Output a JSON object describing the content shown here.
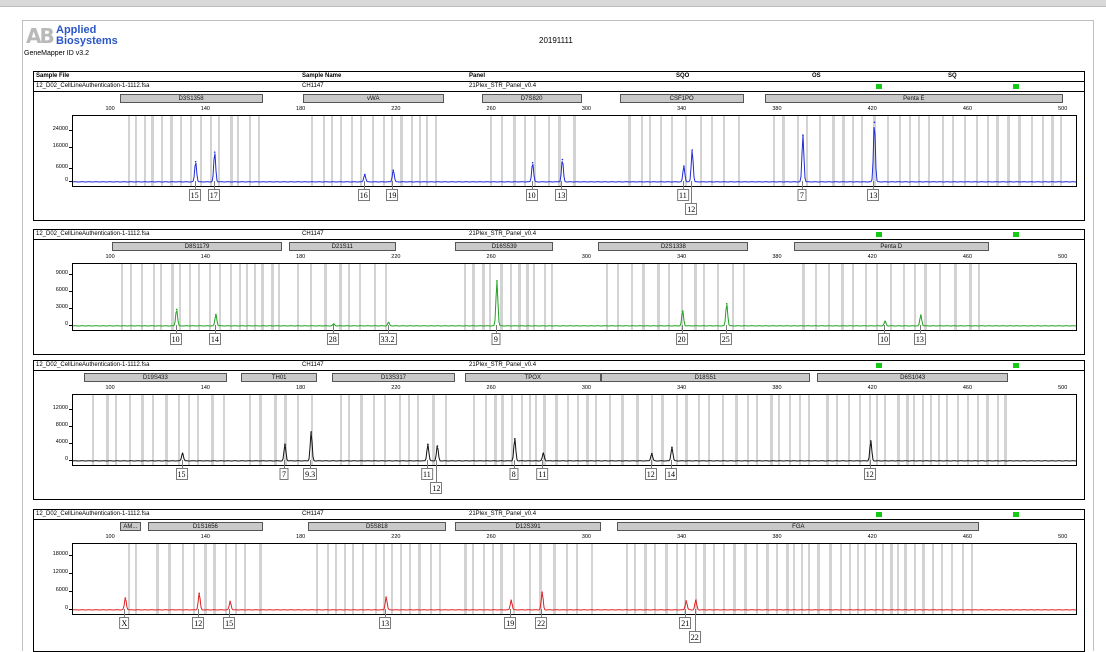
{
  "brand": {
    "mark": "AB",
    "name_line1": "Applied",
    "name_line2": "Biosystems"
  },
  "software": "GeneMapper ID v3.2",
  "run_date": "20191111",
  "columns": {
    "sample_file": "Sample File",
    "sample_name": "Sample Name",
    "panel": "Panel",
    "sqo": "SQO",
    "os": "OS",
    "sq": "SQ"
  },
  "colors": {
    "quality_ok": "#18c918",
    "blue_dye": "#1f2bd8",
    "green_dye": "#1fa21f",
    "black_dye": "#111111",
    "red_dye": "#e02020",
    "bin": "#d3d3d3"
  },
  "bp_axis": [
    100,
    140,
    180,
    220,
    260,
    300,
    340,
    380,
    420,
    460,
    500
  ],
  "panels": [
    {
      "dye": "blue",
      "color": "#1f2bd8",
      "sample_file": "12_D02_CellLineAuthentication-1-1112.fsa",
      "sample_name": "CH1147",
      "panel": "21Plex_STR_Panel_v0.4",
      "loci": [
        {
          "name": "D3S1358",
          "from": 104,
          "to": 164
        },
        {
          "name": "vWA",
          "from": 181,
          "to": 240
        },
        {
          "name": "D7S820",
          "from": 256,
          "to": 298
        },
        {
          "name": "CSF1PO",
          "from": 314,
          "to": 366
        },
        {
          "name": "Penta E",
          "from": 375,
          "to": 500
        }
      ],
      "yticks": [
        0,
        6000,
        16000,
        24000
      ],
      "ymax": 30000,
      "peaks": [
        {
          "bp": 135.5,
          "height": 9500,
          "label": "15"
        },
        {
          "bp": 143.5,
          "height": 14000,
          "label": "17"
        },
        {
          "bp": 206.5,
          "height": 3500,
          "label": "16"
        },
        {
          "bp": 218.5,
          "height": 5500,
          "label": "19"
        },
        {
          "bp": 277,
          "height": 9000,
          "label": "10"
        },
        {
          "bp": 289.5,
          "height": 10500,
          "label": "13"
        },
        {
          "bp": 340.5,
          "height": 7500,
          "label": "11"
        },
        {
          "bp": 344,
          "height": 15000,
          "label": "12",
          "low": true
        },
        {
          "bp": 390.5,
          "height": 22000,
          "label": "7"
        },
        {
          "bp": 420.5,
          "height": 28000,
          "label": "13"
        }
      ]
    },
    {
      "dye": "green",
      "color": "#1fa21f",
      "sample_file": "12_D02_CellLineAuthentication-1-1112.fsa",
      "sample_name": "CH1147",
      "panel": "21Plex_STR_Panel_v0.4",
      "loci": [
        {
          "name": "D8S1179",
          "from": 101,
          "to": 172
        },
        {
          "name": "D21S11",
          "from": 175,
          "to": 220
        },
        {
          "name": "D16S539",
          "from": 245,
          "to": 286
        },
        {
          "name": "D2S1338",
          "from": 305,
          "to": 368
        },
        {
          "name": "Penta D",
          "from": 387,
          "to": 469
        }
      ],
      "yticks": [
        0,
        3000,
        6000,
        9000
      ],
      "ymax": 10500,
      "peaks": [
        {
          "bp": 127.5,
          "height": 2900,
          "label": "10"
        },
        {
          "bp": 144,
          "height": 2000,
          "label": "14"
        },
        {
          "bp": 193.5,
          "height": 350,
          "label": "28"
        },
        {
          "bp": 216.5,
          "height": 600,
          "label": "33.2"
        },
        {
          "bp": 262,
          "height": 7900,
          "label": "9"
        },
        {
          "bp": 340,
          "height": 2600,
          "label": "20"
        },
        {
          "bp": 358.5,
          "height": 3900,
          "label": "25"
        },
        {
          "bp": 425,
          "height": 800,
          "label": "10"
        },
        {
          "bp": 440,
          "height": 1900,
          "label": "13"
        }
      ]
    },
    {
      "dye": "black",
      "color": "#111111",
      "sample_file": "12_D02_CellLineAuthentication-1-1112.fsa",
      "sample_name": "CH1147",
      "panel": "21Plex_STR_Panel_v0.4",
      "loci": [
        {
          "name": "D19S433",
          "from": 89,
          "to": 149
        },
        {
          "name": "TH01",
          "from": 155,
          "to": 187
        },
        {
          "name": "D13S317",
          "from": 193,
          "to": 245
        },
        {
          "name": "TPOX",
          "from": 249,
          "to": 306
        },
        {
          "name": "D18S51",
          "from": 306,
          "to": 394
        },
        {
          "name": "D6S1043",
          "from": 397,
          "to": 477
        }
      ],
      "yticks": [
        0,
        4000,
        8000,
        12000
      ],
      "ymax": 15000,
      "peaks": [
        {
          "bp": 130,
          "height": 1800,
          "label": "15"
        },
        {
          "bp": 173,
          "height": 3900,
          "label": "7"
        },
        {
          "bp": 184,
          "height": 6800,
          "label": "9.3"
        },
        {
          "bp": 233,
          "height": 3900,
          "label": "11"
        },
        {
          "bp": 237,
          "height": 3500,
          "label": "12",
          "low": true
        },
        {
          "bp": 269.5,
          "height": 5200,
          "label": "8"
        },
        {
          "bp": 281.5,
          "height": 1800,
          "label": "11"
        },
        {
          "bp": 327,
          "height": 1700,
          "label": "12"
        },
        {
          "bp": 335.5,
          "height": 3200,
          "label": "14"
        },
        {
          "bp": 419,
          "height": 4700,
          "label": "12"
        }
      ]
    },
    {
      "dye": "red",
      "color": "#e02020",
      "sample_file": "12_D02_CellLineAuthentication-1-1112.fsa",
      "sample_name": "CH1147",
      "panel": "21Plex_STR_Panel_v0.4",
      "loci": [
        {
          "name": "AM...",
          "from": 104,
          "to": 113
        },
        {
          "name": "D1S1656",
          "from": 116,
          "to": 164
        },
        {
          "name": "D5S818",
          "from": 183,
          "to": 241
        },
        {
          "name": "D12S391",
          "from": 245,
          "to": 306
        },
        {
          "name": "FGA",
          "from": 313,
          "to": 465
        }
      ],
      "yticks": [
        0,
        6000,
        12000,
        18000
      ],
      "ymax": 21500,
      "peaks": [
        {
          "bp": 106,
          "height": 4000,
          "label": "X"
        },
        {
          "bp": 137,
          "height": 5600,
          "label": "12"
        },
        {
          "bp": 150,
          "height": 2800,
          "label": "15"
        },
        {
          "bp": 215.5,
          "height": 4300,
          "label": "13"
        },
        {
          "bp": 268,
          "height": 3200,
          "label": "19"
        },
        {
          "bp": 281,
          "height": 6000,
          "label": "22"
        },
        {
          "bp": 341.5,
          "height": 3000,
          "label": "21"
        },
        {
          "bp": 345.5,
          "height": 3200,
          "label": "22",
          "low": true
        }
      ]
    }
  ]
}
